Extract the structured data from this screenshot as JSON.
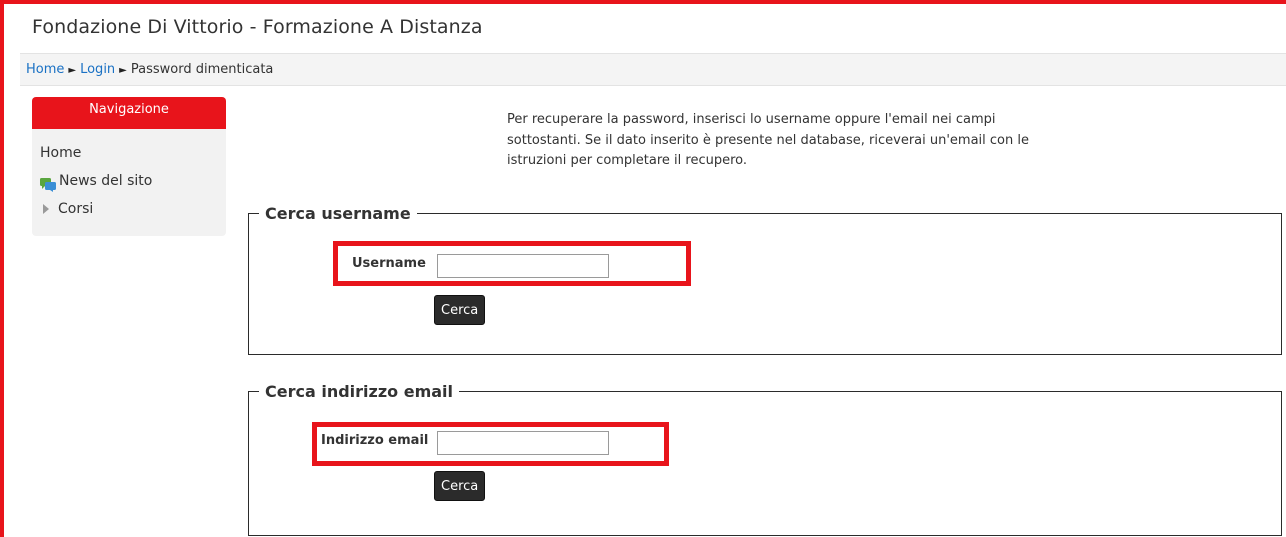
{
  "header": {
    "title": "Fondazione Di Vittorio - Formazione A Distanza"
  },
  "breadcrumb": {
    "items": [
      "Home",
      "Login",
      "Password dimenticata"
    ],
    "separator": "►"
  },
  "navigation": {
    "title": "Navigazione",
    "items": [
      {
        "label": "Home",
        "icon": null
      },
      {
        "label": "News del sito",
        "icon": "forum-icon"
      },
      {
        "label": "Corsi",
        "icon": "triangle-right-icon"
      }
    ]
  },
  "intro": {
    "text": "Per recuperare la password, inserisci lo username oppure l'email nei campi sottostanti. Se il dato inserito è presente nel database, riceverai un'email con le istruzioni per completare il recupero."
  },
  "search_username": {
    "legend": "Cerca username",
    "label": "Username",
    "value": "",
    "button": "Cerca"
  },
  "search_email": {
    "legend": "Cerca indirizzo email",
    "label": "Indirizzo email",
    "value": "",
    "button": "Cerca"
  },
  "colors": {
    "accent": "#e8141b",
    "link": "#1a71c4",
    "button_bg": "#2b2b2b"
  }
}
